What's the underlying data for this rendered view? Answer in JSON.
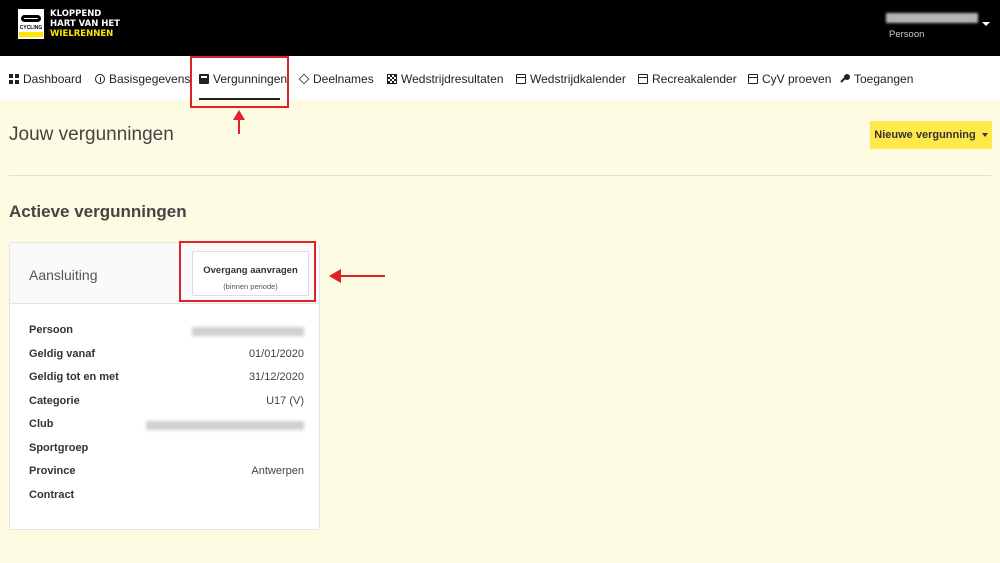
{
  "header": {
    "logo": {
      "badge_text": "CYCLING",
      "line1": "KLOPPEND",
      "line2": "HART VAN HET",
      "line3": "WIELRENNEN"
    },
    "user": {
      "role": "Persoon"
    }
  },
  "nav": {
    "items": [
      {
        "label": "Dashboard",
        "icon": "grid-icon"
      },
      {
        "label": "Basisgegevens",
        "icon": "info-icon"
      },
      {
        "label": "Vergunningen",
        "icon": "book-icon",
        "active": true
      },
      {
        "label": "Deelnames",
        "icon": "layers-icon"
      },
      {
        "label": "Wedstrijdresultaten",
        "icon": "checkered-flag-icon"
      },
      {
        "label": "Wedstrijdkalender",
        "icon": "calendar-icon"
      },
      {
        "label": "Recreakalender",
        "icon": "calendar-icon"
      },
      {
        "label": "CyV proeven",
        "icon": "calendar-icon"
      },
      {
        "label": "Toegangen",
        "icon": "key-icon"
      }
    ]
  },
  "main": {
    "page_title": "Jouw vergunningen",
    "new_button_label": "Nieuwe vergunning",
    "section_title": "Actieve vergunningen",
    "card": {
      "title": "Aansluiting",
      "transfer_button": {
        "label": "Overgang aanvragen",
        "sublabel": "(binnen periode)"
      },
      "fields": [
        {
          "label": "Persoon",
          "value": ""
        },
        {
          "label": "Geldig vanaf",
          "value": "01/01/2020"
        },
        {
          "label": "Geldig tot en met",
          "value": "31/12/2020"
        },
        {
          "label": "Categorie",
          "value": "U17 (V)"
        },
        {
          "label": "Club",
          "value": ""
        },
        {
          "label": "Sportgroep",
          "value": ""
        },
        {
          "label": "Province",
          "value": "Antwerpen"
        },
        {
          "label": "Contract",
          "value": ""
        }
      ]
    }
  },
  "colors": {
    "accent_yellow": "#ffe94a",
    "annotation_red": "#e0202a",
    "page_background": "#fdfce3"
  }
}
